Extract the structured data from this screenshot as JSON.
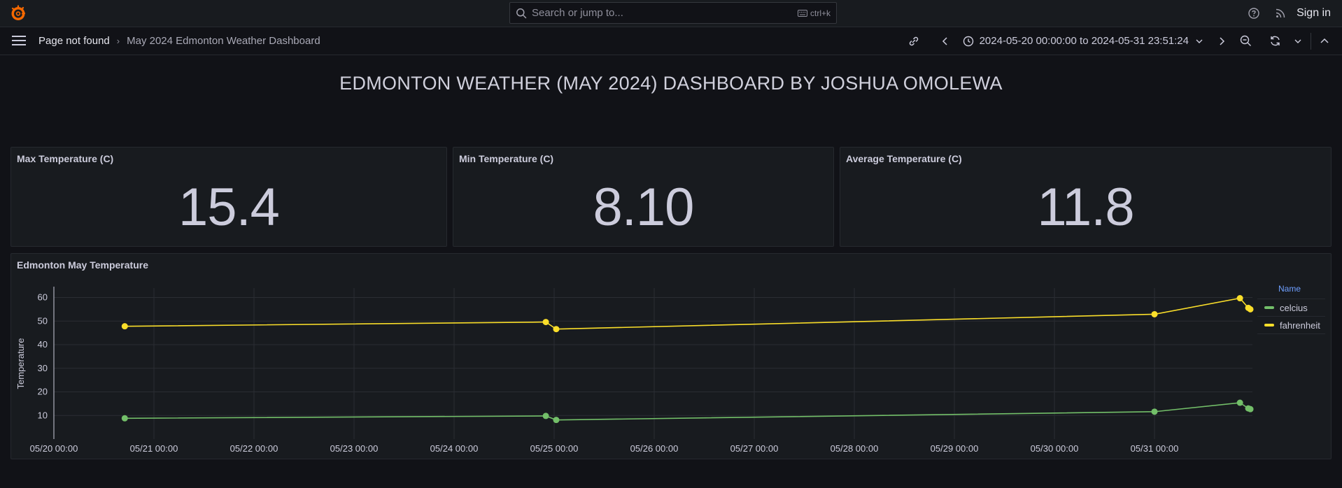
{
  "topbar": {
    "search_placeholder": "Search or jump to...",
    "search_shortcut": "ctrl+k",
    "signin_label": "Sign in"
  },
  "navbar": {
    "breadcrumb_root": "Page not found",
    "breadcrumb_current": "May 2024 Edmonton Weather Dashboard",
    "time_range": "2024-05-20 00:00:00 to 2024-05-31 23:51:24"
  },
  "dashboard": {
    "title": "EDMONTON WEATHER (MAY 2024) DASHBOARD BY JOSHUA OMOLEWA"
  },
  "stats": [
    {
      "title": "Max Temperature (C)",
      "value": "15.4"
    },
    {
      "title": "Min Temperature (C)",
      "value": "8.10"
    },
    {
      "title": "Average Temperature (C)",
      "value": "11.8"
    }
  ],
  "timeseries_panel": {
    "title": "Edmonton May Temperature",
    "legend_header": "Name"
  },
  "colors": {
    "accent": "#6e9fff",
    "celcius": "#73bf69",
    "fahrenheit": "#fade2a",
    "background": "#111217",
    "panel": "#181b1f"
  },
  "chart_data": {
    "type": "line",
    "ylabel": "Temperature",
    "ylim": [
      0,
      64
    ],
    "yticks": [
      10,
      20,
      30,
      40,
      50,
      60
    ],
    "xlim": [
      "2024-05-20 00:00",
      "2024-05-31 23:51"
    ],
    "xticks": [
      "05/20 00:00",
      "05/21 00:00",
      "05/22 00:00",
      "05/23 00:00",
      "05/24 00:00",
      "05/25 00:00",
      "05/26 00:00",
      "05/27 00:00",
      "05/28 00:00",
      "05/29 00:00",
      "05/30 00:00",
      "05/31 00:00"
    ],
    "grid": true,
    "legend_position": "right",
    "x": [
      "2024-05-20 17:00",
      "2024-05-24 22:00",
      "2024-05-25 00:30",
      "2024-05-31 00:00",
      "2024-05-31 20:30",
      "2024-05-31 22:30",
      "2024-05-31 23:00"
    ],
    "series": [
      {
        "name": "celcius",
        "label": "celcius",
        "color": "#73bf69",
        "values": [
          8.8,
          9.8,
          8.1,
          11.6,
          15.4,
          13.0,
          12.7
        ]
      },
      {
        "name": "fahrenheit",
        "label": "fahrenheit",
        "color": "#fade2a",
        "values": [
          47.8,
          49.6,
          46.6,
          52.9,
          59.7,
          55.6,
          55.0
        ]
      }
    ]
  }
}
